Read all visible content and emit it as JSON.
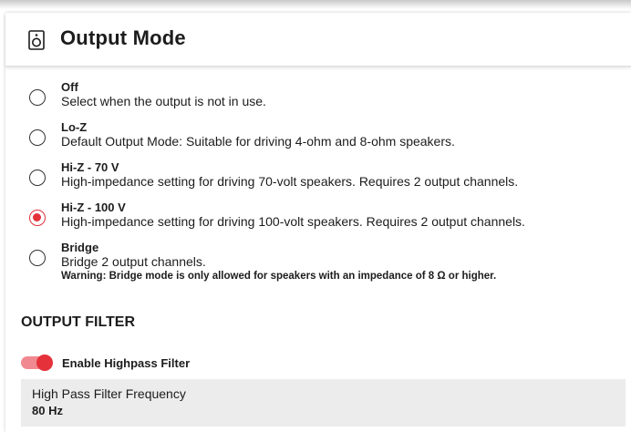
{
  "header": {
    "title": "Output Mode",
    "icon": "speaker-icon"
  },
  "output_modes": [
    {
      "title": "Off",
      "description": "Select when the output is not in use.",
      "selected": false
    },
    {
      "title": "Lo-Z",
      "description": "Default Output Mode: Suitable for driving 4-ohm and 8-ohm speakers.",
      "selected": false
    },
    {
      "title": "Hi-Z - 70 V",
      "description": "High-impedance setting for driving 70-volt speakers. Requires 2 output channels.",
      "selected": false
    },
    {
      "title": "Hi-Z - 100 V",
      "description": "High-impedance setting for driving 100-volt speakers. Requires 2 output channels.",
      "selected": true
    },
    {
      "title": "Bridge",
      "description": "Bridge 2 output channels.",
      "warning": "Warning: Bridge mode is only allowed for speakers with an impedance of 8 Ω or higher.",
      "selected": false
    }
  ],
  "output_filter": {
    "section_title": "OUTPUT FILTER",
    "highpass_toggle": {
      "label": "Enable Highpass Filter",
      "enabled": true
    },
    "frequency": {
      "label": "High Pass Filter Frequency",
      "value": "80 Hz"
    }
  },
  "colors": {
    "accent": "#e5313a",
    "toggle_track": "#f08a90",
    "field_background": "#ececec",
    "text": "#1c1c1c"
  }
}
